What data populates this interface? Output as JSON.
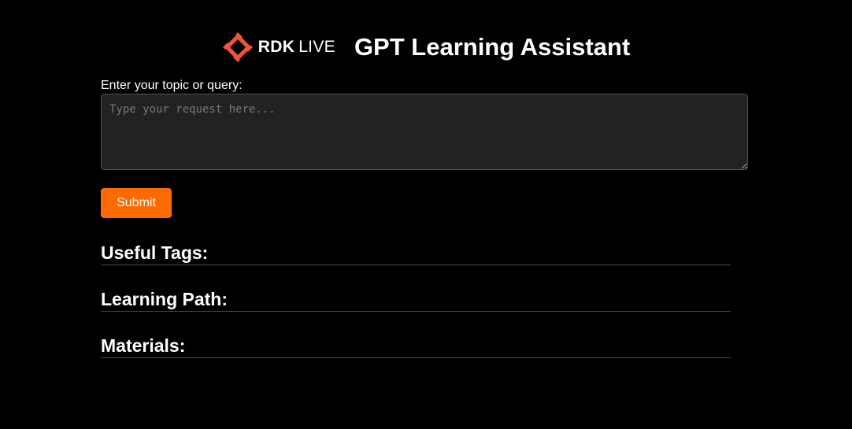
{
  "header": {
    "logo_text_bold": "RDK",
    "logo_text_light": "LIVE",
    "title": "GPT Learning Assistant"
  },
  "form": {
    "label": "Enter your topic or query:",
    "placeholder": "Type your request here...",
    "value": "",
    "submit_label": "Submit"
  },
  "sections": {
    "tags_heading": "Useful Tags:",
    "path_heading": "Learning Path:",
    "materials_heading": "Materials:"
  },
  "colors": {
    "accent": "#ff6a00",
    "logo": "#f0533a",
    "background": "#000000",
    "input_bg": "#222222"
  },
  "icons": {
    "logo": "rdk-live-logo-icon"
  }
}
